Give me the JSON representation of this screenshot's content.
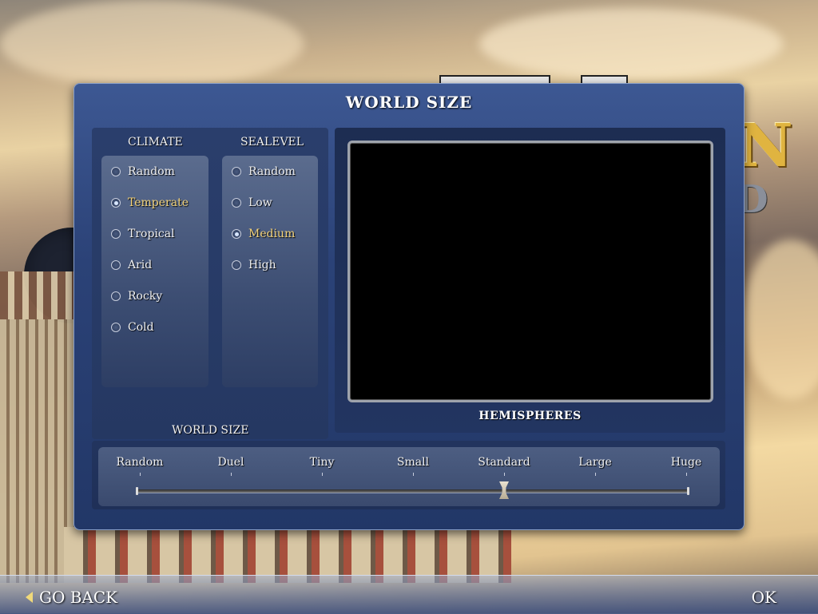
{
  "dialog": {
    "title": "WORLD SIZE"
  },
  "climate": {
    "header": "CLIMATE",
    "options": [
      "Random",
      "Temperate",
      "Tropical",
      "Arid",
      "Rocky",
      "Cold"
    ],
    "selected": "Temperate"
  },
  "sealevel": {
    "header": "SEALEVEL",
    "options": [
      "Random",
      "Low",
      "Medium",
      "High"
    ],
    "selected": "Medium"
  },
  "world_size": {
    "section_label": "WORLD SIZE",
    "options": [
      "Random",
      "Duel",
      "Tiny",
      "Small",
      "Standard",
      "Large",
      "Huge"
    ],
    "selected": "Standard"
  },
  "preview": {
    "caption": "HEMISPHERES"
  },
  "bottom_bar": {
    "go_back_label": "GO BACK",
    "ok_label": "OK"
  },
  "colors": {
    "selected_text": "#f2d27a",
    "dialog_blue": "#2b4277",
    "accent_gold": "#e0b440"
  },
  "icons": {
    "go_back": "chevron-left-icon",
    "radio_on": "radio-selected-icon",
    "radio_off": "radio-empty-icon",
    "slider_thumb": "slider-thumb-icon"
  }
}
